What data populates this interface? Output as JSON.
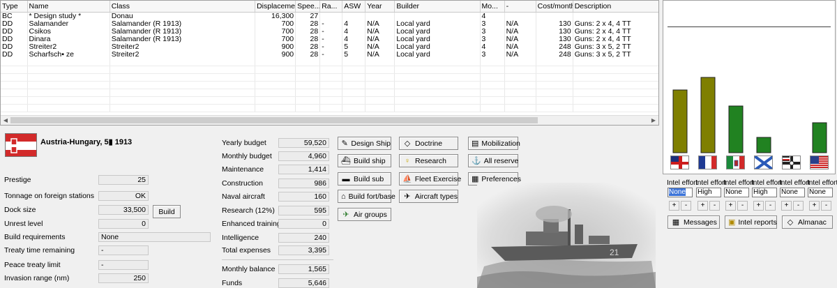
{
  "table": {
    "columns": [
      "Type",
      "Name",
      "Class",
      "Displacement",
      "Spee...",
      "Ra...",
      "ASW",
      "Year",
      "Builder",
      "Mo...",
      "-",
      "Cost/month",
      "Description"
    ],
    "rows": [
      [
        "BC",
        "* Design study *",
        "Donau",
        "16,300",
        "27",
        "",
        "",
        "",
        "",
        "4",
        "",
        "",
        ""
      ],
      [
        "DD",
        "Salamander",
        "Salamander (R 1913)",
        "700",
        "28",
        "-",
        "4",
        "N/A",
        "Local yard",
        "3",
        "N/A",
        "130",
        "Guns: 2 x 4, 4 TT"
      ],
      [
        "DD",
        "Csikos",
        "Salamander (R 1913)",
        "700",
        "28",
        "-",
        "4",
        "N/A",
        "Local yard",
        "3",
        "N/A",
        "130",
        "Guns: 2 x 4, 4 TT"
      ],
      [
        "DD",
        "Dinara",
        "Salamander (R 1913)",
        "700",
        "28",
        "-",
        "4",
        "N/A",
        "Local yard",
        "3",
        "N/A",
        "130",
        "Guns: 2 x 4, 4 TT"
      ],
      [
        "DD",
        "Streiter2",
        "Streiter2",
        "900",
        "28",
        "-",
        "5",
        "N/A",
        "Local yard",
        "4",
        "N/A",
        "248",
        "Guns: 3 x 5, 2 TT"
      ],
      [
        "DD",
        "Scharfsch▪ ze",
        "Streiter2",
        "900",
        "28",
        "-",
        "5",
        "N/A",
        "Local yard",
        "3",
        "N/A",
        "248",
        "Guns: 3 x 5, 2 TT"
      ]
    ]
  },
  "country": {
    "title": "Austria-Hungary, 5▮ 1913"
  },
  "stats_left": [
    {
      "label": "Prestige",
      "value": "25"
    },
    {
      "label": "Tonnage on foreign stations",
      "value": "OK"
    },
    {
      "label": "Dock size",
      "value": "33,500"
    },
    {
      "label": "Unrest level",
      "value": "0"
    },
    {
      "label": "Build requirements",
      "value": "None"
    },
    {
      "label": "Treaty time remaining",
      "value": "-"
    },
    {
      "label": "Peace treaty limit",
      "value": "-"
    },
    {
      "label": "Invasion range (nm)",
      "value": "250"
    }
  ],
  "build_button": "Build",
  "budget": [
    {
      "label": "Yearly budget",
      "value": "59,520"
    },
    {
      "label": "Monthly budget",
      "value": "4,960"
    },
    {
      "label": "Maintenance",
      "value": "1,414"
    },
    {
      "label": "Construction",
      "value": "986"
    },
    {
      "label": "Naval aircraft",
      "value": "160"
    },
    {
      "label": "Research (12%)",
      "value": "595"
    },
    {
      "label": "Enhanced training",
      "value": "0"
    },
    {
      "label": "Intelligence",
      "value": "240"
    },
    {
      "label": "Total expenses",
      "value": "3,395"
    },
    {
      "label": "Monthly balance",
      "value": "1,565"
    },
    {
      "label": "Funds",
      "value": "5,646"
    }
  ],
  "buttons": {
    "design_ship": "Design Ship",
    "build_ship": "Build ship",
    "build_sub": "Build sub",
    "build_fort": "Build fort/base",
    "air_groups": "Air groups",
    "doctrine": "Doctrine",
    "research": "Research",
    "fleet_exercise": "Fleet Exercise",
    "aircraft_types": "Aircraft types",
    "mobilization": "Mobilization",
    "all_reserve": "All reserve",
    "preferences": "Preferences",
    "messages": "Messages",
    "intel_reports": "Intel reports",
    "almanac": "Almanac"
  },
  "chart_data": {
    "type": "bar",
    "categories": [
      "uk-flag",
      "france-flag",
      "italy-flag",
      "russia-flag",
      "germany-flag",
      "usa-flag"
    ],
    "values": [
      0.5,
      0.6,
      0.37,
      0.12,
      0,
      0.24
    ],
    "colors": [
      "#7f7f00",
      "#7f7f00",
      "#218221",
      "#218221",
      "#218221",
      "#218221"
    ]
  },
  "intel": {
    "label": "Intel effort",
    "values": [
      "None",
      "High",
      "None",
      "High",
      "None",
      "None"
    ],
    "plus": "+",
    "minus": "-"
  }
}
